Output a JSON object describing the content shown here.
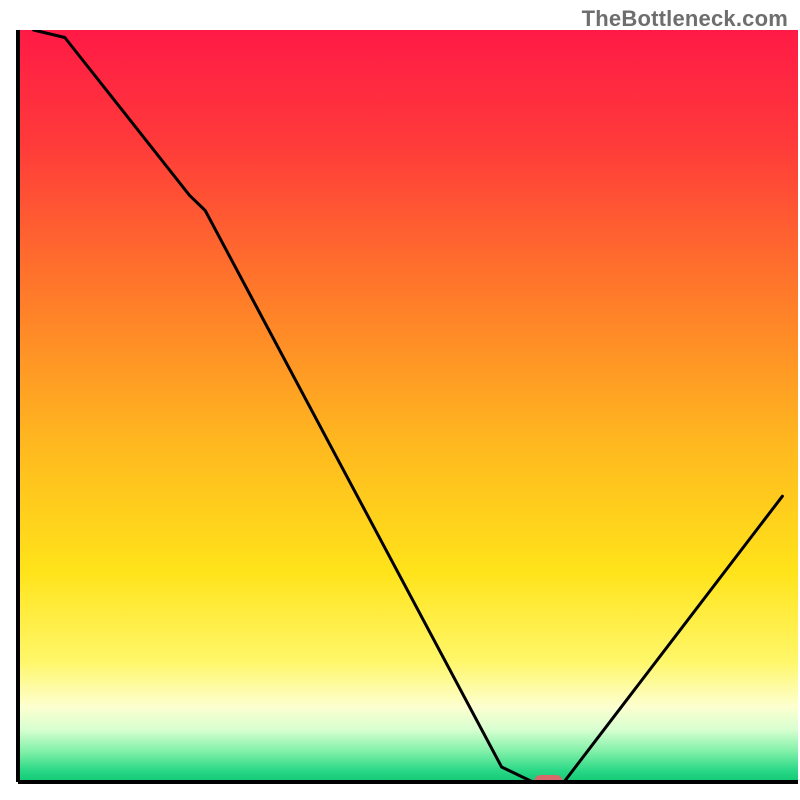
{
  "watermark": "TheBottleneck.com",
  "chart_data": {
    "type": "line",
    "title": "",
    "xlabel": "",
    "ylabel": "",
    "xlim": [
      0,
      100
    ],
    "ylim": [
      0,
      100
    ],
    "x": [
      2,
      6,
      22,
      24,
      62,
      66,
      70,
      98
    ],
    "values": [
      100,
      99,
      78,
      76,
      2,
      0,
      0,
      38
    ],
    "optimum_zone": {
      "x_start": 65,
      "x_end": 71,
      "y": 0
    },
    "gradient_stops": [
      {
        "offset": 0.0,
        "color": "#ff1a46"
      },
      {
        "offset": 0.15,
        "color": "#ff3a3a"
      },
      {
        "offset": 0.35,
        "color": "#ff7a2a"
      },
      {
        "offset": 0.55,
        "color": "#ffb81f"
      },
      {
        "offset": 0.72,
        "color": "#ffe31a"
      },
      {
        "offset": 0.84,
        "color": "#fff76a"
      },
      {
        "offset": 0.9,
        "color": "#fdffd0"
      },
      {
        "offset": 0.93,
        "color": "#d8ffd0"
      },
      {
        "offset": 0.96,
        "color": "#7ff0a8"
      },
      {
        "offset": 0.985,
        "color": "#29d886"
      },
      {
        "offset": 1.0,
        "color": "#12c874"
      }
    ],
    "marker": {
      "x": 68,
      "y": 0,
      "color": "#d66a6a"
    }
  }
}
